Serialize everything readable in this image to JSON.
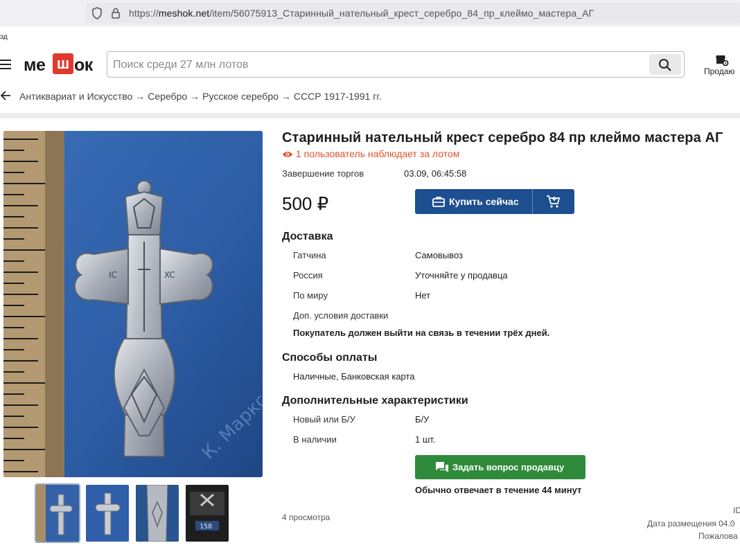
{
  "browser": {
    "url_prefix": "https://",
    "url_host": "meshok.net",
    "url_path": "/item/56075913_Старинный_нательный_крест_серебро_84_пр_клеймо_мастера_АГ"
  },
  "edge_text": "эд",
  "header": {
    "logo_left": "ме",
    "logo_mid": "ш",
    "logo_right": "ок",
    "search_placeholder": "Поиск среди 27 млн лотов",
    "search_value": "",
    "sell_label": "Продаю"
  },
  "breadcrumb": {
    "items": [
      "Антиквариат и Искусство",
      "Серебро",
      "Русское серебро",
      "СССР 1917-1991 гг."
    ],
    "separator": "→"
  },
  "lot": {
    "title": "Старинный нательный крест серебро 84 пр клеймо мастера АГ",
    "watchers": "1 пользователь наблюдает за лотом",
    "end_label": "Завершение торгов",
    "end_value": "03.09, 06:45:58",
    "price": "500 ₽",
    "buy_label": "Купить сейчас",
    "photo_watermark": "К. Маркс",
    "scale_reading": "158"
  },
  "delivery": {
    "heading": "Доставка",
    "rows": [
      {
        "label": "Гатчина",
        "value": "Самовывоз"
      },
      {
        "label": "Россия",
        "value": "Уточняйте у продавца"
      },
      {
        "label": "По миру",
        "value": "Нет"
      }
    ],
    "extra_label": "Доп. условия доставки",
    "extra_note": "Покупатель должен выйти на связь в течении трёх дней."
  },
  "payment": {
    "heading": "Способы оплаты",
    "methods": "Наличные, Банковская карта"
  },
  "characteristics": {
    "heading": "Дополнительные характеристики",
    "rows": [
      {
        "label": "Новый или Б/У",
        "value": "Б/У"
      },
      {
        "label": "В наличии",
        "value": "1 шт."
      }
    ]
  },
  "seller": {
    "ask_label": "Задать вопрос продавцу",
    "reply_time": "Обычно отвечает в течение 44 минут"
  },
  "footer": {
    "views": "4 просмотра",
    "id_label": "ID",
    "posted": "Дата размещения 04.0",
    "complain": "Пожалова"
  },
  "colors": {
    "buy_button": "#1d4e8f",
    "ask_button": "#2f8b3b",
    "watchers_text": "#e0522b"
  }
}
